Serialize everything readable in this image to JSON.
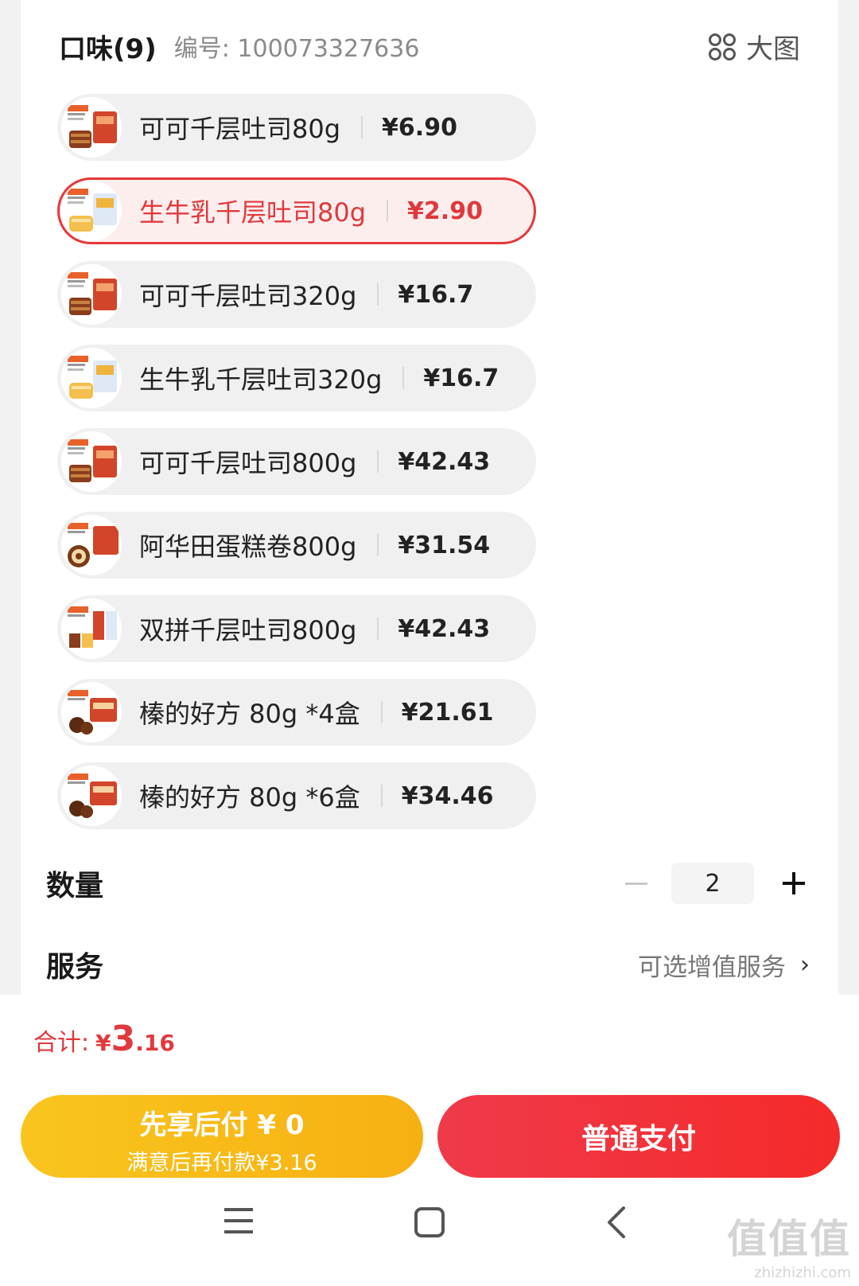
{
  "header": {
    "title": "口味(9)",
    "sku": "编号: 100073327636",
    "big_view_label": "大图",
    "big_view_icon": "grid-icon"
  },
  "options": [
    {
      "name": "可可千层吐司80g",
      "price": "¥6.90",
      "selected": false,
      "thumb": "cocoa"
    },
    {
      "name": "生牛乳千层吐司80g",
      "price": "¥2.90",
      "selected": true,
      "thumb": "milk"
    },
    {
      "name": "可可千层吐司320g",
      "price": "¥16.7",
      "selected": false,
      "thumb": "cocoa"
    },
    {
      "name": "生牛乳千层吐司320g",
      "price": "¥16.7",
      "selected": false,
      "thumb": "milk"
    },
    {
      "name": "可可千层吐司800g",
      "price": "¥42.43",
      "selected": false,
      "thumb": "cocoa"
    },
    {
      "name": "阿华田蛋糕卷800g",
      "price": "¥31.54",
      "selected": false,
      "thumb": "roll"
    },
    {
      "name": "双拼千层吐司800g",
      "price": "¥42.43",
      "selected": false,
      "thumb": "mixed"
    },
    {
      "name": "榛的好方 80g *4盒",
      "price": "¥21.61",
      "selected": false,
      "thumb": "hazelnut"
    },
    {
      "name": "榛的好方 80g *6盒",
      "price": "¥34.46",
      "selected": false,
      "thumb": "hazelnut"
    }
  ],
  "quantity": {
    "label": "数量",
    "value": "2"
  },
  "service": {
    "label": "服务",
    "value": "可选增值服务",
    "chevron": "›"
  },
  "summary": {
    "label": "合计:",
    "currency": "¥",
    "amount_int": "3",
    "amount_dec": ".16"
  },
  "actions": {
    "bnpl_main": "先享后付 ¥ 0",
    "bnpl_sub": "满意后再付款¥3.16",
    "pay_label": "普通支付"
  },
  "watermark": {
    "logo": "值值值",
    "url": "zhizhizhi.com"
  },
  "colors": {
    "accent_red": "#e0393d",
    "bnpl_yellow": "#f9c51e",
    "pay_red": "#f52a2a"
  }
}
